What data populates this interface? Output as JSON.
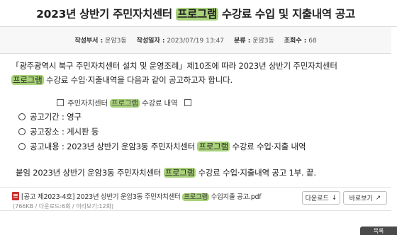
{
  "title": {
    "prefix": "2023년 상반기 주민자치센터 ",
    "highlight": "프로그램",
    "suffix": " 수강료 수입 및 지출내역 공고"
  },
  "meta": {
    "author_label": "작성부서 :",
    "author": "운암3동",
    "date_label": "작성일자 :",
    "date": "2023/07/19 13:47",
    "category_label": "분류 :",
    "category": "운암3동",
    "views_label": "조회수 :",
    "views": "68"
  },
  "body": {
    "p1_line1": "「광주광역시 북구 주민자치센터 설치 및 운영조례」제10조에 따라 2023년 상반기 주민자치센터",
    "p1_line2_highlight": "프로그램",
    "p1_line2_rest": " 수강료 수입·지출내역을 다음과 같이 공고하고자 합니다.",
    "center_prefix": "주민자치센터 ",
    "center_highlight": "프로그램",
    "center_suffix": " 수강료 내역",
    "item1": "공고기간 : 영구",
    "item2": "공고장소 : 게시판 등",
    "item3_prefix": "공고내용 : 2023년 상반기 운암3동 주민자치센터 ",
    "item3_highlight": "프로그램",
    "item3_suffix": " 수강료 수입·지출 내역",
    "closing_prefix": "붙임   2023년 상반기 운암3동 주민자치센터 ",
    "closing_highlight": "프로그램",
    "closing_suffix": " 수강료 수입·지출내역 공고 1부.   끝."
  },
  "attachment": {
    "icon": "pdf-icon",
    "name_prefix": "[공고 제2023-4호] 2023년 상반기 운암3동 주민자치센터 ",
    "name_highlight": "프로그램",
    "name_suffix": " 수입지출 공고.pdf",
    "meta": "(766KB / 다운로드:6회 / 미리보기:12회)",
    "download_label": "다운로드",
    "download_icon": "↓",
    "preview_label": "바로보기",
    "preview_icon": "↗"
  },
  "corner_button": "목록"
}
